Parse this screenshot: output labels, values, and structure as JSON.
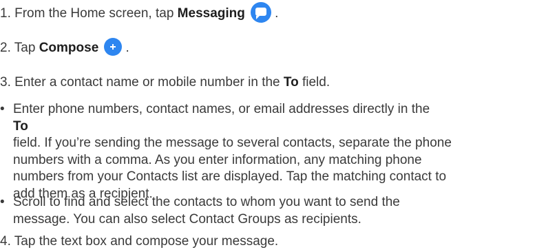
{
  "steps": {
    "step1": {
      "prefix": "1. From the Home screen, tap ",
      "bold": "Messaging",
      "suffix": " .",
      "icon": "messaging-icon"
    },
    "step2": {
      "prefix": "2. Tap ",
      "bold": "Compose",
      "suffix": " .",
      "icon": "compose-plus-icon"
    },
    "step3": {
      "prefix": "3. Enter a contact name or mobile number in the ",
      "bold": "To",
      "suffix": " field."
    },
    "step4": {
      "text": "4. Tap the text box and compose your message."
    }
  },
  "bullets": {
    "bullet_char": "•",
    "b1": {
      "line1_pre": "Enter phone numbers, contact names, or email addresses directly in the ",
      "line1_bold": "To",
      "line2": "field. If you’re sending the message to several contacts, separate the phone",
      "line3": "numbers with a comma. As you enter information, any matching phone",
      "line4": "numbers from your Contacts list are displayed. Tap the matching contact to",
      "line5": "add them as a recipient."
    },
    "b2": {
      "line1": "Scroll to find and select the contacts to whom you want to send the",
      "line2": "message. You can also select Contact Groups as recipients."
    }
  },
  "colors": {
    "accent": "#2e86f0",
    "text": "#3a3a3a"
  }
}
